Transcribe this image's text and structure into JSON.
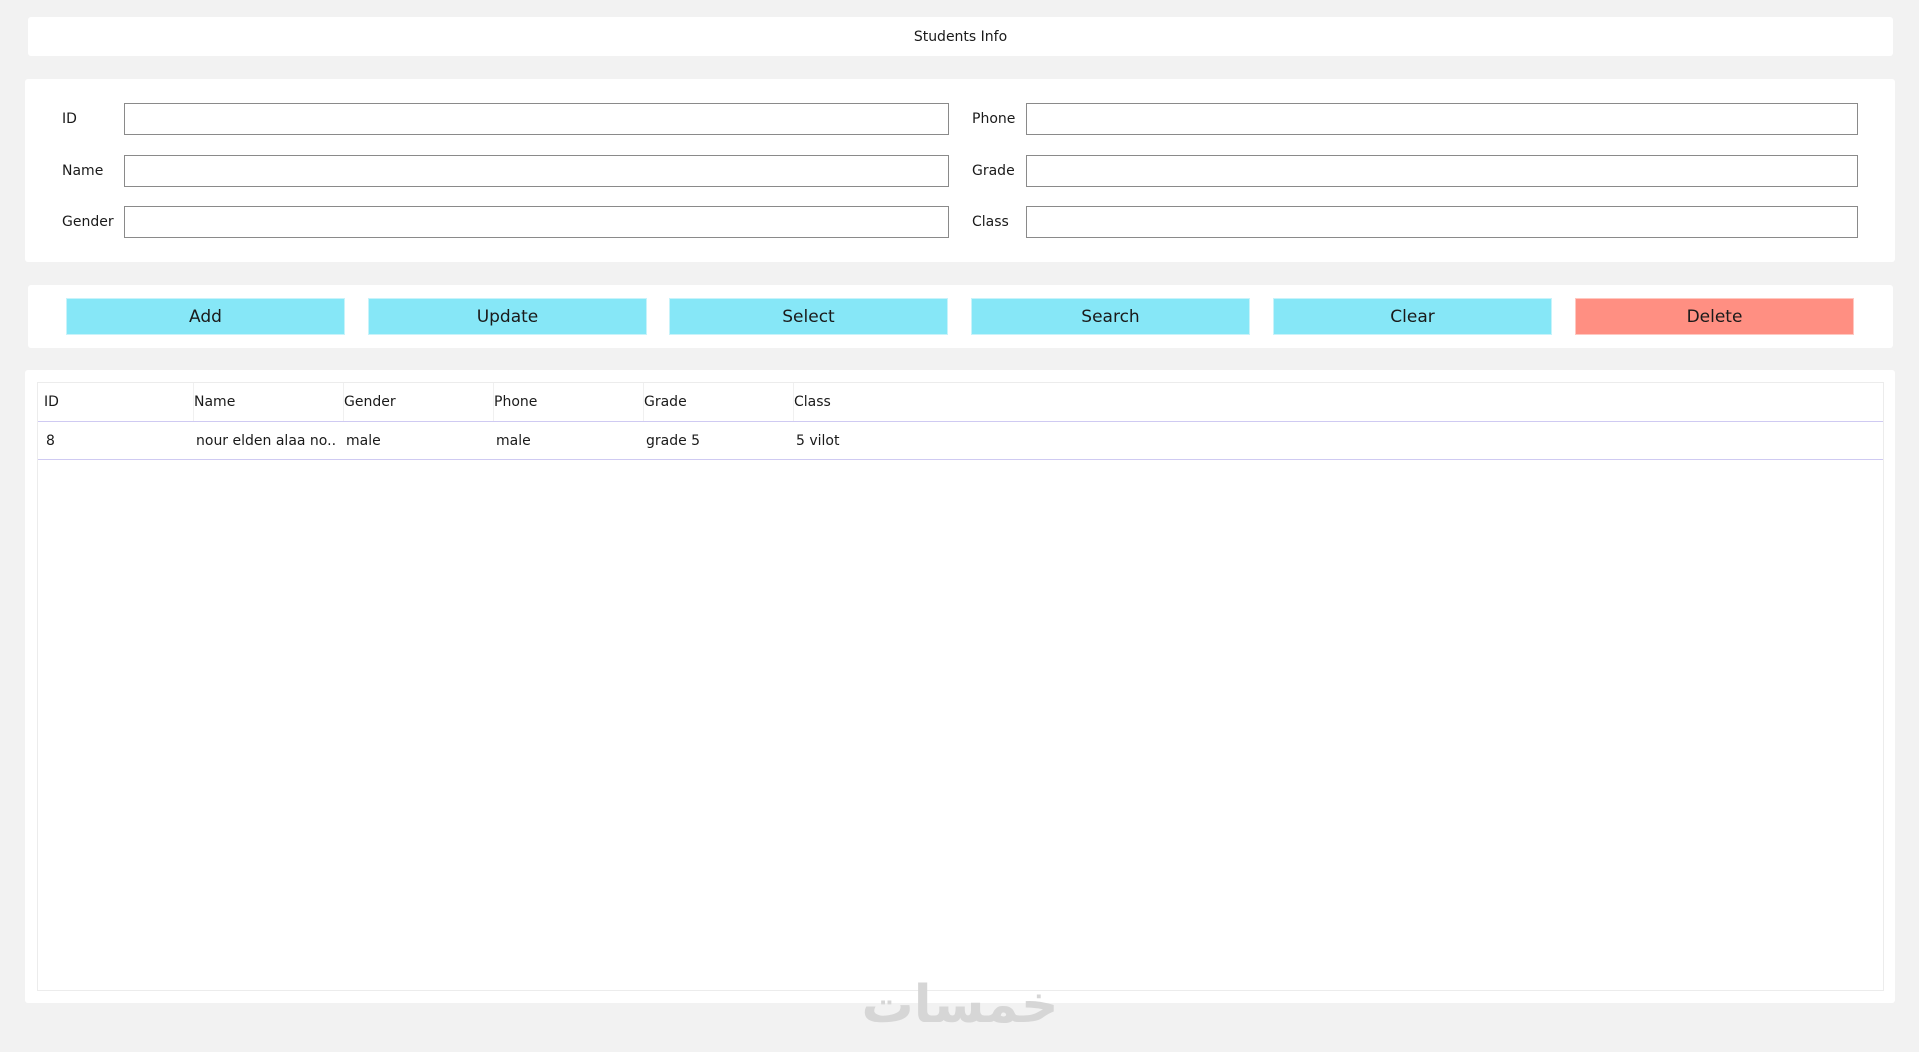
{
  "window": {
    "title": "Students Info"
  },
  "form": {
    "fields": [
      {
        "label": "ID",
        "value": ""
      },
      {
        "label": "Name",
        "value": ""
      },
      {
        "label": "Gender",
        "value": ""
      },
      {
        "label": "Phone",
        "value": ""
      },
      {
        "label": "Grade",
        "value": ""
      },
      {
        "label": "Class",
        "value": ""
      }
    ]
  },
  "buttons": {
    "add": "Add",
    "update": "Update",
    "select": "Select",
    "search": "Search",
    "clear": "Clear",
    "delete": "Delete"
  },
  "table": {
    "columns": [
      "ID",
      "Name",
      "Gender",
      "Phone",
      "Grade",
      "Class"
    ],
    "rows": [
      {
        "id": "8",
        "name": "nour elden alaa no...",
        "gender": "male",
        "phone": "male",
        "grade": "grade 5",
        "class": "5 vilot"
      }
    ]
  },
  "watermark": "خمسات",
  "colors": {
    "button_accent": "#86e7f7",
    "delete_accent": "#ff8f82",
    "row_separator": "#cfcaf2"
  }
}
